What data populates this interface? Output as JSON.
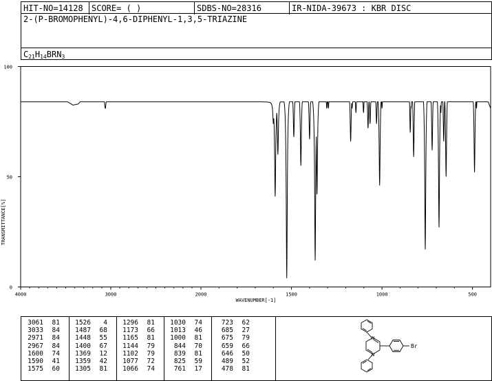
{
  "header": {
    "hit_no": "HIT-NO=14128",
    "score": "SCORE=  (   )",
    "sdbs_no": "SDBS-NO=28316",
    "source": "IR-NIDA-39673 : KBR DISC"
  },
  "compound": {
    "name": "2-(P-BROMOPHENYL)-4,6-DIPHENYL-1,3,5-TRIAZINE",
    "formula_parts": [
      {
        "text": "C",
        "sub": false
      },
      {
        "text": "21",
        "sub": true
      },
      {
        "text": "H",
        "sub": false
      },
      {
        "text": "14",
        "sub": true
      },
      {
        "text": "BRN",
        "sub": false
      },
      {
        "text": "3",
        "sub": true
      }
    ]
  },
  "structure": {
    "substituent_label": "Br"
  },
  "chart_data": {
    "type": "line",
    "title": "",
    "xlabel": "WAVENUMBER[-1]",
    "ylabel": "TRANSMITTANCE[%]",
    "xlim": [
      4000,
      400
    ],
    "ylim": [
      0,
      100
    ],
    "x_ticks": [
      4000,
      3000,
      2000,
      1500,
      1000,
      500
    ],
    "y_ticks": [
      0,
      50,
      100
    ],
    "grid": false,
    "baseline_points": [
      [
        4000,
        93.5
      ],
      [
        3900,
        93.5
      ],
      [
        3800,
        93
      ],
      [
        3700,
        92
      ],
      [
        3620,
        90
      ],
      [
        3550,
        87
      ],
      [
        3480,
        84
      ],
      [
        3420,
        82.5
      ],
      [
        3360,
        83
      ],
      [
        3300,
        86
      ],
      [
        3240,
        89
      ],
      [
        3180,
        90.5
      ],
      [
        3120,
        90
      ],
      [
        3000,
        91.5
      ],
      [
        2900,
        93
      ],
      [
        2700,
        93.8
      ],
      [
        2500,
        94
      ],
      [
        2200,
        94.2
      ],
      [
        2000,
        94.2
      ],
      [
        1900,
        93.8
      ],
      [
        1800,
        93
      ],
      [
        1700,
        91
      ],
      [
        1650,
        89
      ],
      [
        1620,
        86
      ],
      [
        1600,
        84
      ],
      [
        1570,
        86
      ],
      [
        1500,
        90
      ],
      [
        1420,
        90
      ],
      [
        1350,
        88
      ],
      [
        1300,
        90
      ],
      [
        1250,
        92
      ],
      [
        1200,
        91
      ],
      [
        1150,
        90
      ],
      [
        1100,
        91
      ],
      [
        1050,
        90
      ],
      [
        1000,
        92
      ],
      [
        950,
        93
      ],
      [
        900,
        93
      ],
      [
        850,
        95
      ],
      [
        800,
        92
      ],
      [
        750,
        93
      ],
      [
        700,
        93
      ],
      [
        650,
        93
      ],
      [
        600,
        92
      ],
      [
        550,
        94
      ],
      [
        500,
        93
      ],
      [
        450,
        92
      ],
      [
        400,
        81
      ]
    ],
    "peaks": [
      {
        "wavenumber": 3061,
        "transmittance": 81
      },
      {
        "wavenumber": 3033,
        "transmittance": 84
      },
      {
        "wavenumber": 2971,
        "transmittance": 84
      },
      {
        "wavenumber": 2967,
        "transmittance": 84
      },
      {
        "wavenumber": 1600,
        "transmittance": 74
      },
      {
        "wavenumber": 1590,
        "transmittance": 41
      },
      {
        "wavenumber": 1575,
        "transmittance": 60
      },
      {
        "wavenumber": 1526,
        "transmittance": 4
      },
      {
        "wavenumber": 1487,
        "transmittance": 68
      },
      {
        "wavenumber": 1448,
        "transmittance": 55
      },
      {
        "wavenumber": 1400,
        "transmittance": 67
      },
      {
        "wavenumber": 1369,
        "transmittance": 12
      },
      {
        "wavenumber": 1359,
        "transmittance": 42
      },
      {
        "wavenumber": 1305,
        "transmittance": 81
      },
      {
        "wavenumber": 1296,
        "transmittance": 81
      },
      {
        "wavenumber": 1173,
        "transmittance": 66
      },
      {
        "wavenumber": 1165,
        "transmittance": 81
      },
      {
        "wavenumber": 1144,
        "transmittance": 79
      },
      {
        "wavenumber": 1102,
        "transmittance": 79
      },
      {
        "wavenumber": 1077,
        "transmittance": 72
      },
      {
        "wavenumber": 1066,
        "transmittance": 74
      },
      {
        "wavenumber": 1030,
        "transmittance": 74
      },
      {
        "wavenumber": 1013,
        "transmittance": 46
      },
      {
        "wavenumber": 1000,
        "transmittance": 81
      },
      {
        "wavenumber": 844,
        "transmittance": 70
      },
      {
        "wavenumber": 839,
        "transmittance": 81
      },
      {
        "wavenumber": 825,
        "transmittance": 59
      },
      {
        "wavenumber": 761,
        "transmittance": 17
      },
      {
        "wavenumber": 723,
        "transmittance": 62
      },
      {
        "wavenumber": 685,
        "transmittance": 27
      },
      {
        "wavenumber": 675,
        "transmittance": 79
      },
      {
        "wavenumber": 659,
        "transmittance": 66
      },
      {
        "wavenumber": 646,
        "transmittance": 50
      },
      {
        "wavenumber": 489,
        "transmittance": 52
      },
      {
        "wavenumber": 478,
        "transmittance": 81
      }
    ]
  },
  "peak_table": {
    "columns": [
      [
        [
          "3061",
          "81"
        ],
        [
          "3033",
          "84"
        ],
        [
          "2971",
          "84"
        ],
        [
          "2967",
          "84"
        ],
        [
          "1600",
          "74"
        ],
        [
          "1590",
          "41"
        ],
        [
          "1575",
          "60"
        ]
      ],
      [
        [
          "1526",
          "4"
        ],
        [
          "1487",
          "68"
        ],
        [
          "1448",
          "55"
        ],
        [
          "1400",
          "67"
        ],
        [
          "1369",
          "12"
        ],
        [
          "1359",
          "42"
        ],
        [
          "1305",
          "81"
        ]
      ],
      [
        [
          "1296",
          "81"
        ],
        [
          "1173",
          "66"
        ],
        [
          "1165",
          "81"
        ],
        [
          "1144",
          "79"
        ],
        [
          "1102",
          "79"
        ],
        [
          "1077",
          "72"
        ],
        [
          "1066",
          "74"
        ]
      ],
      [
        [
          "1030",
          "74"
        ],
        [
          "1013",
          "46"
        ],
        [
          "1000",
          "81"
        ],
        [
          "844",
          "70"
        ],
        [
          "839",
          "81"
        ],
        [
          "825",
          "59"
        ],
        [
          "761",
          "17"
        ]
      ],
      [
        [
          "723",
          "62"
        ],
        [
          "685",
          "27"
        ],
        [
          "675",
          "79"
        ],
        [
          "659",
          "66"
        ],
        [
          "646",
          "50"
        ],
        [
          "489",
          "52"
        ],
        [
          "478",
          "81"
        ]
      ]
    ]
  }
}
